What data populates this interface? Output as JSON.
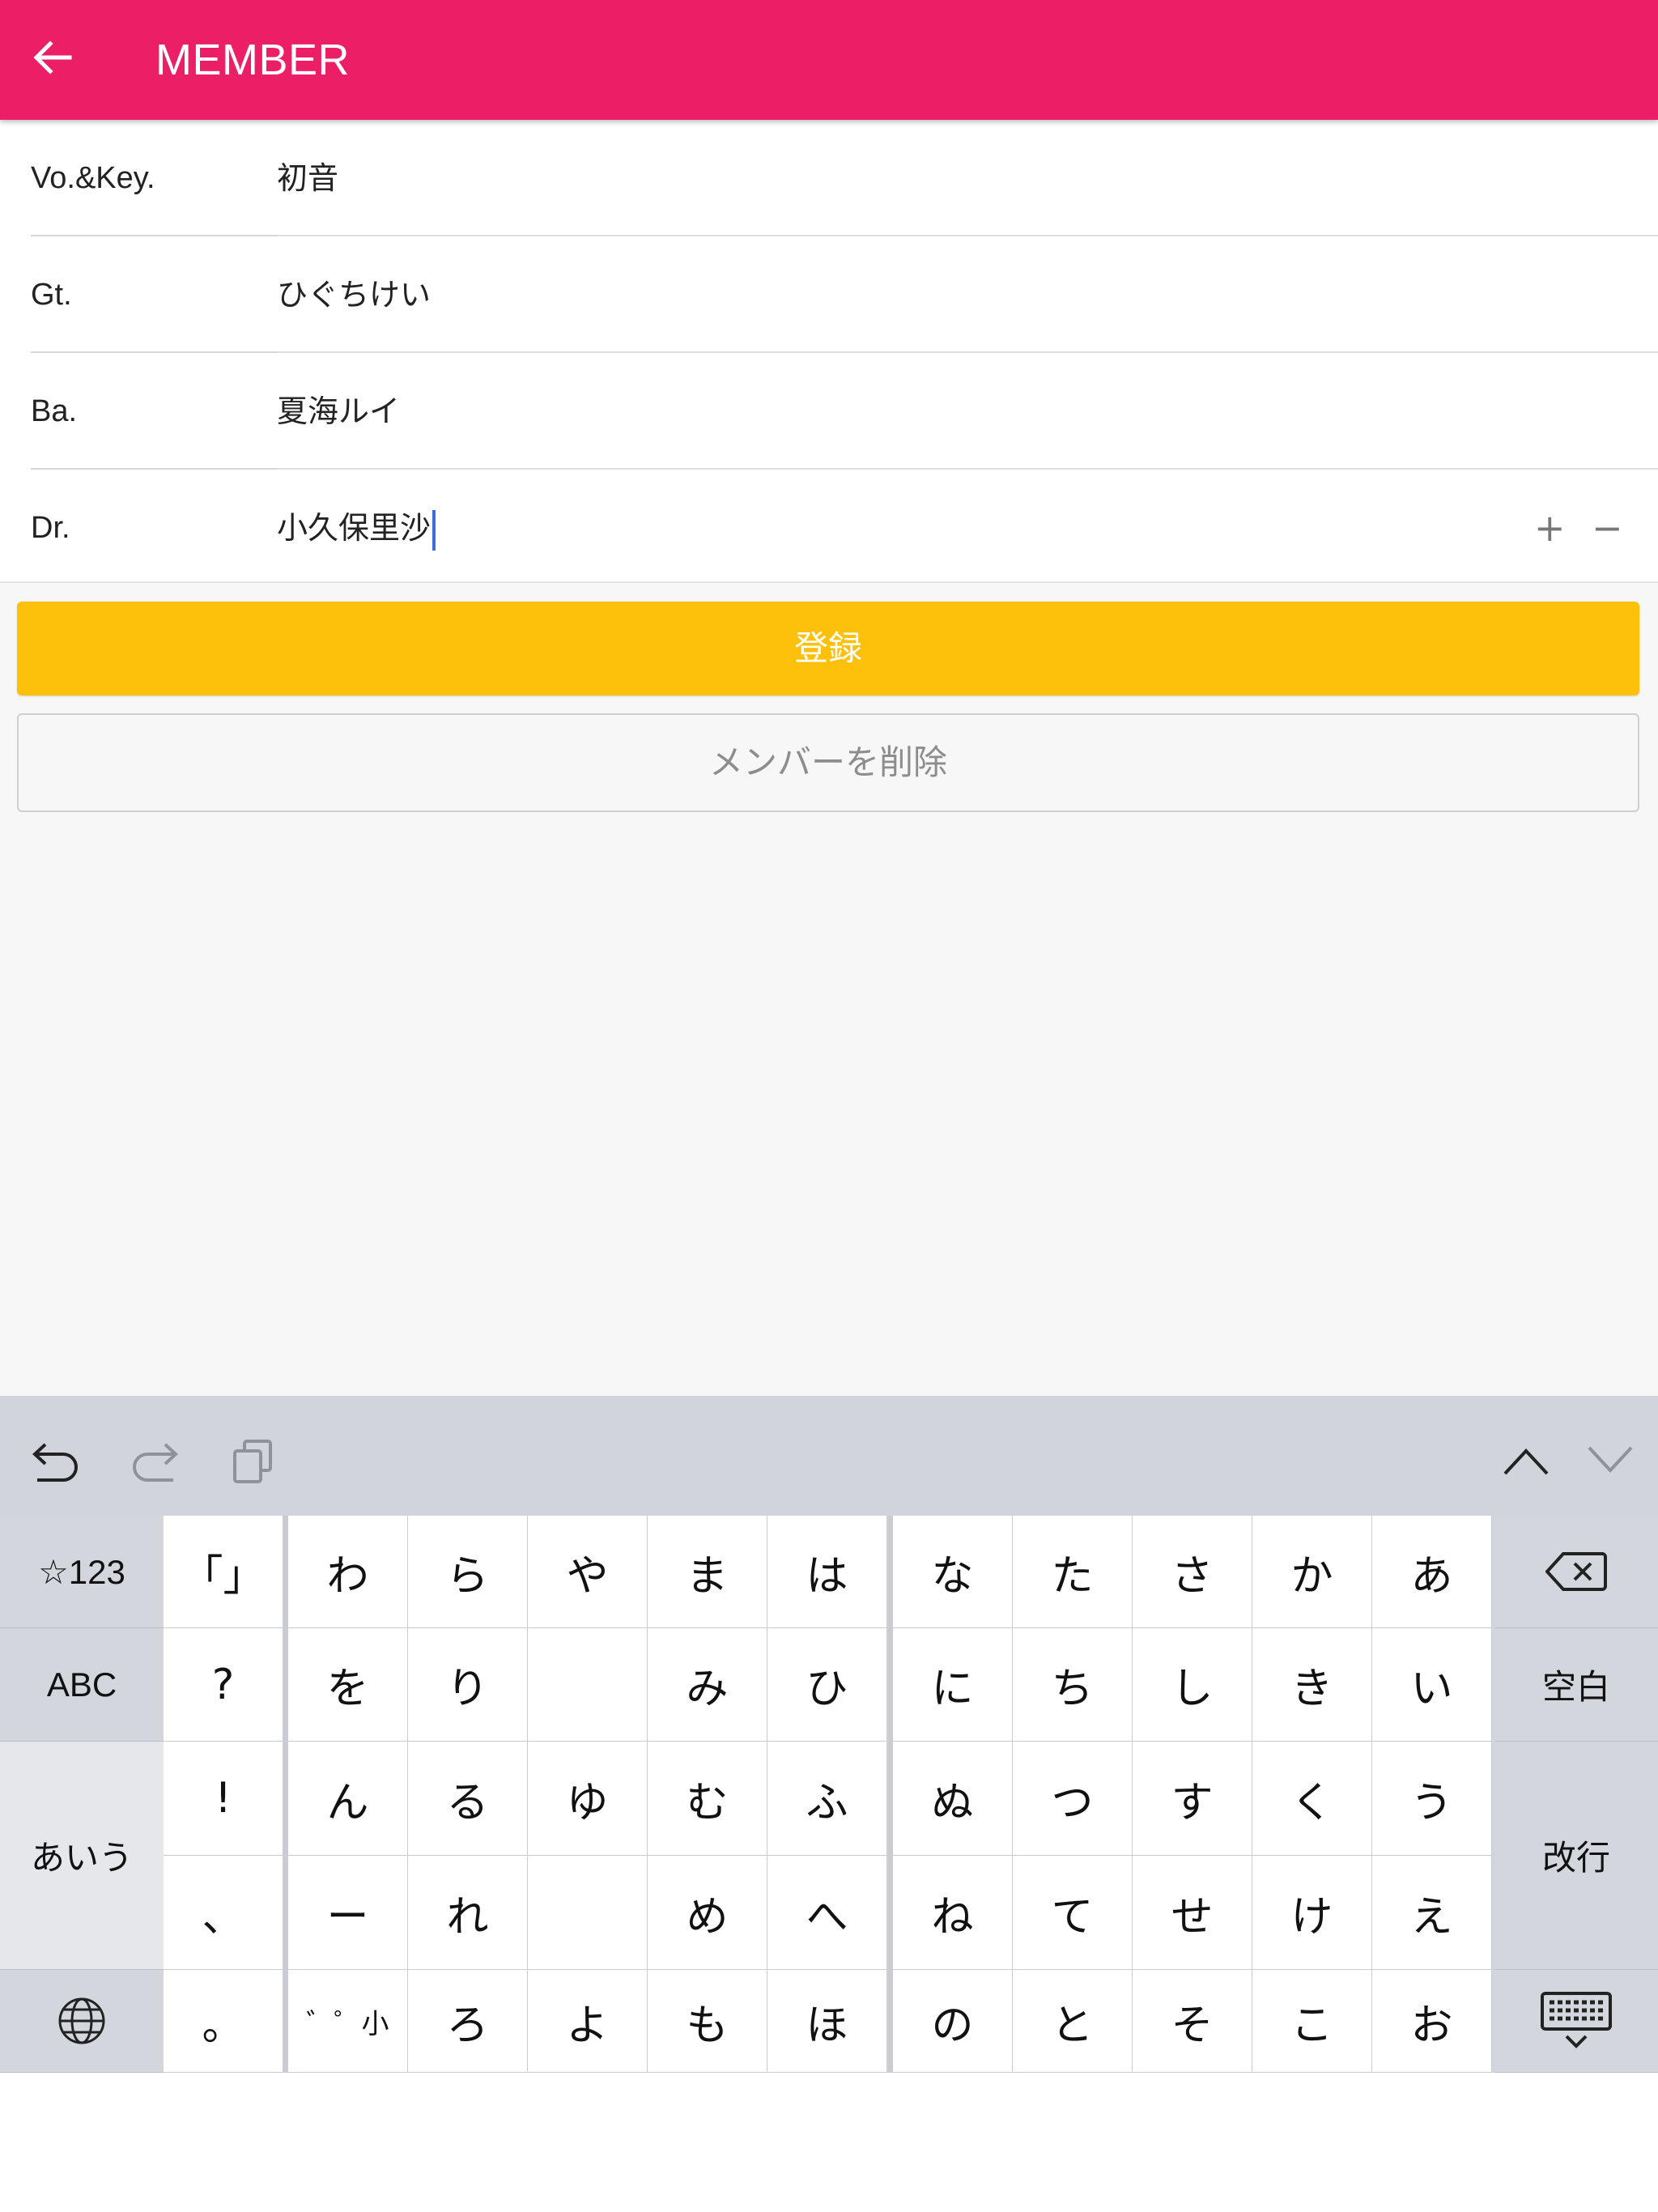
{
  "header": {
    "title": "MEMBER",
    "back_icon": "arrow-left-icon",
    "color": "#ec1f66"
  },
  "members": [
    {
      "part": "Vo.&Key.",
      "name": "初音"
    },
    {
      "part": "Gt.",
      "name": "ひぐちけい"
    },
    {
      "part": "Ba.",
      "name": "夏海ルイ"
    },
    {
      "part": "Dr.",
      "name": "小久保里沙"
    }
  ],
  "row_controls": {
    "plus": "+",
    "minus": "−"
  },
  "buttons": {
    "register": "登録",
    "delete": "メンバーを削除",
    "register_color": "#fdc00b"
  },
  "keyboard": {
    "toolbar": [
      "undo-icon",
      "redo-icon",
      "paste-icon",
      "chevron-up-icon",
      "chevron-down-icon"
    ],
    "left": {
      "numbers": "☆123",
      "abc": "ABC",
      "kana": "あいう",
      "globe": "globe-icon"
    },
    "right": {
      "delete": "delete-icon",
      "space": "空白",
      "enter": "改行",
      "dismiss": "keyboard-hide-icon"
    },
    "punct": [
      "「」",
      "?",
      "!",
      "、",
      "。"
    ],
    "columns": [
      [
        "わ",
        "を",
        "ん",
        "ー",
        "゛゜小"
      ],
      [
        "ら",
        "り",
        "る",
        "れ",
        "ろ"
      ],
      [
        "や",
        "",
        "ゆ",
        "",
        "よ"
      ],
      [
        "ま",
        "み",
        "む",
        "め",
        "も"
      ],
      [
        "は",
        "ひ",
        "ふ",
        "へ",
        "ほ"
      ],
      [
        "な",
        "に",
        "ぬ",
        "ね",
        "の"
      ],
      [
        "た",
        "ち",
        "つ",
        "て",
        "と"
      ],
      [
        "さ",
        "し",
        "す",
        "せ",
        "そ"
      ],
      [
        "か",
        "き",
        "く",
        "け",
        "こ"
      ],
      [
        "あ",
        "い",
        "う",
        "え",
        "お"
      ]
    ]
  }
}
